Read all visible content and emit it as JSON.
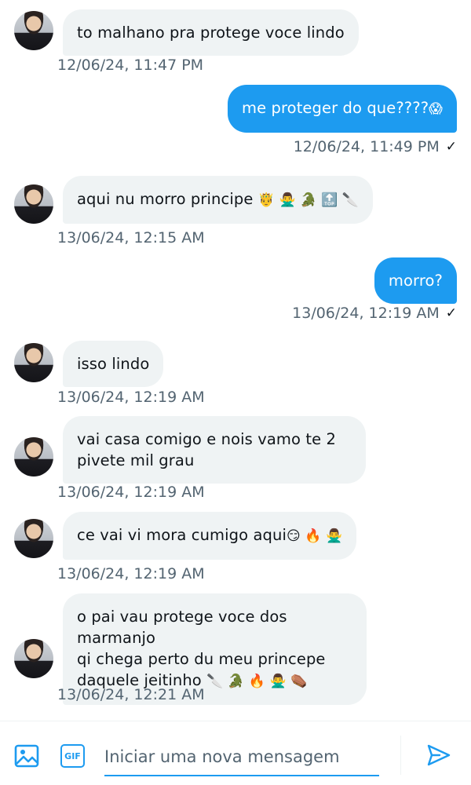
{
  "messages": [
    {
      "text": "to malhano pra protege voce lindo",
      "time": "12/06/24, 11:47 PM"
    },
    {
      "text": "me proteger do que????",
      "emoji": "😱",
      "time": "12/06/24, 11:49 PM",
      "check": "✓"
    },
    {
      "text": "aqui nu morro principe",
      "emoji": "🤴 🙅‍♂️ 🐊 🔝 🔪",
      "time": "13/06/24, 12:15 AM"
    },
    {
      "text": "morro?",
      "time": "13/06/24, 12:19 AM",
      "check": "✓"
    },
    {
      "text": "isso lindo",
      "time": "13/06/24, 12:19 AM"
    },
    {
      "line1": "vai casa comigo e nois vamo te 2",
      "line2": "pivete mil grau",
      "time": "13/06/24, 12:19 AM"
    },
    {
      "text": "ce vai vi mora cumigo aqui",
      "emoji": "😏 🔥 🙅‍♂️",
      "time": "13/06/24, 12:19 AM"
    },
    {
      "line1": "o pai vau protege voce dos marmanjo",
      "line2": "qi chega perto du meu princepe",
      "line3": "daquele jeitinho",
      "emoji": "🔪 🐊 🔥 🙅‍♂️ ⚰️",
      "time": "13/06/24, 12:21 AM"
    }
  ],
  "composer": {
    "placeholder": "Iniciar uma nova mensagem",
    "gif_label": "GIF"
  },
  "colors": {
    "accent": "#1d9bf0",
    "incoming_bubble": "#eff3f4",
    "timestamp": "#536471"
  },
  "icons": [
    "avatar",
    "image-icon",
    "gif-icon",
    "send-icon",
    "check-icon"
  ]
}
